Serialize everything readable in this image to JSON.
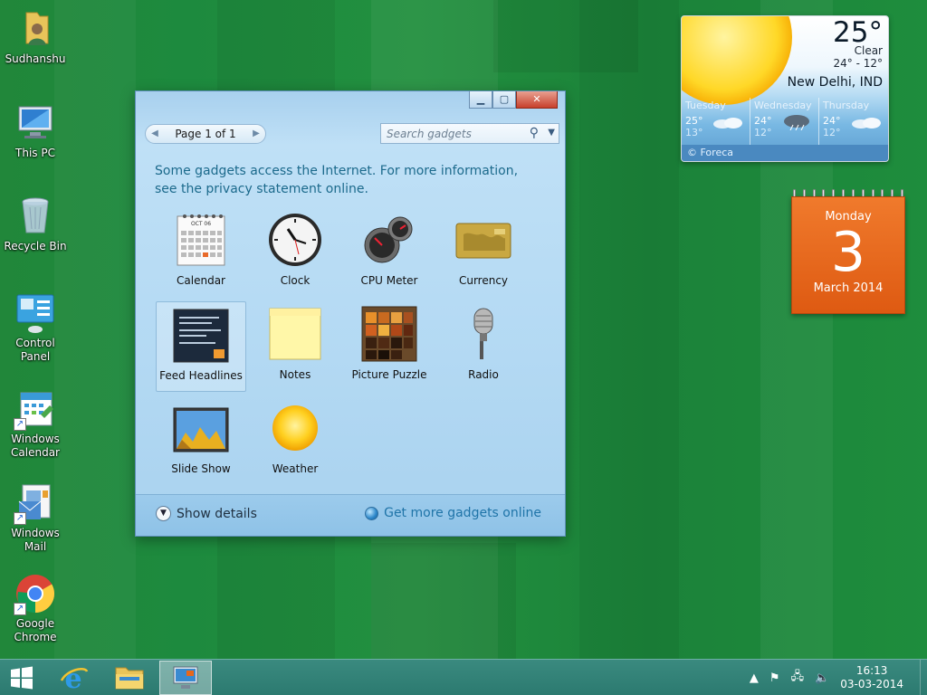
{
  "desktop_icons": [
    {
      "label": "Sudhanshu",
      "icon": "user-folder-icon"
    },
    {
      "label": "This PC",
      "icon": "computer-icon"
    },
    {
      "label": "Recycle Bin",
      "icon": "recycle-bin-icon"
    },
    {
      "label": "Control Panel",
      "icon": "control-panel-icon"
    },
    {
      "label": "Windows Calendar",
      "icon": "calendar-app-icon"
    },
    {
      "label": "Windows Mail",
      "icon": "mail-icon"
    },
    {
      "label": "Google Chrome",
      "icon": "chrome-icon"
    }
  ],
  "gallery": {
    "page_label": "Page 1 of 1",
    "search_placeholder": "Search gadgets",
    "info_text": "Some gadgets access the Internet.  For more information, see the privacy statement online.",
    "gadgets": [
      {
        "label": "Calendar",
        "icon": "calendar-gadget-icon"
      },
      {
        "label": "Clock",
        "icon": "clock-gadget-icon"
      },
      {
        "label": "CPU Meter",
        "icon": "cpu-meter-gadget-icon"
      },
      {
        "label": "Currency",
        "icon": "currency-gadget-icon"
      },
      {
        "label": "Feed Headlines",
        "icon": "feed-headlines-gadget-icon",
        "selected": true
      },
      {
        "label": "Notes",
        "icon": "notes-gadget-icon"
      },
      {
        "label": "Picture Puzzle",
        "icon": "picture-puzzle-gadget-icon"
      },
      {
        "label": "Radio",
        "icon": "radio-gadget-icon"
      },
      {
        "label": "Slide Show",
        "icon": "slide-show-gadget-icon"
      },
      {
        "label": "Weather",
        "icon": "weather-gadget-icon"
      }
    ],
    "show_details": "Show details",
    "get_more": "Get more gadgets online",
    "calendar_icon_month": "OCT 06"
  },
  "weather": {
    "temp": "25°",
    "condition": "Clear",
    "range": "24° - 12°",
    "city": "New Delhi, IND",
    "forecast": [
      {
        "day": "Tuesday",
        "hi": "25°",
        "lo": "13°"
      },
      {
        "day": "Wednesday",
        "hi": "24°",
        "lo": "12°"
      },
      {
        "day": "Thursday",
        "hi": "24°",
        "lo": "12°"
      }
    ],
    "credit": "© Foreca"
  },
  "calendar_gadget": {
    "day_of_week": "Monday",
    "day": "3",
    "month_year": "March 2014"
  },
  "taskbar": {
    "time": "16:13",
    "date": "03-03-2014",
    "apps": [
      "start-button",
      "internet-explorer",
      "file-explorer",
      "desktop-gadgets"
    ]
  },
  "colors": {
    "desktop_green": "#1f8a3c",
    "taskbar": "#2c7a70",
    "calendar_orange": "#e8671c",
    "info_text": "#1c6a8c"
  }
}
